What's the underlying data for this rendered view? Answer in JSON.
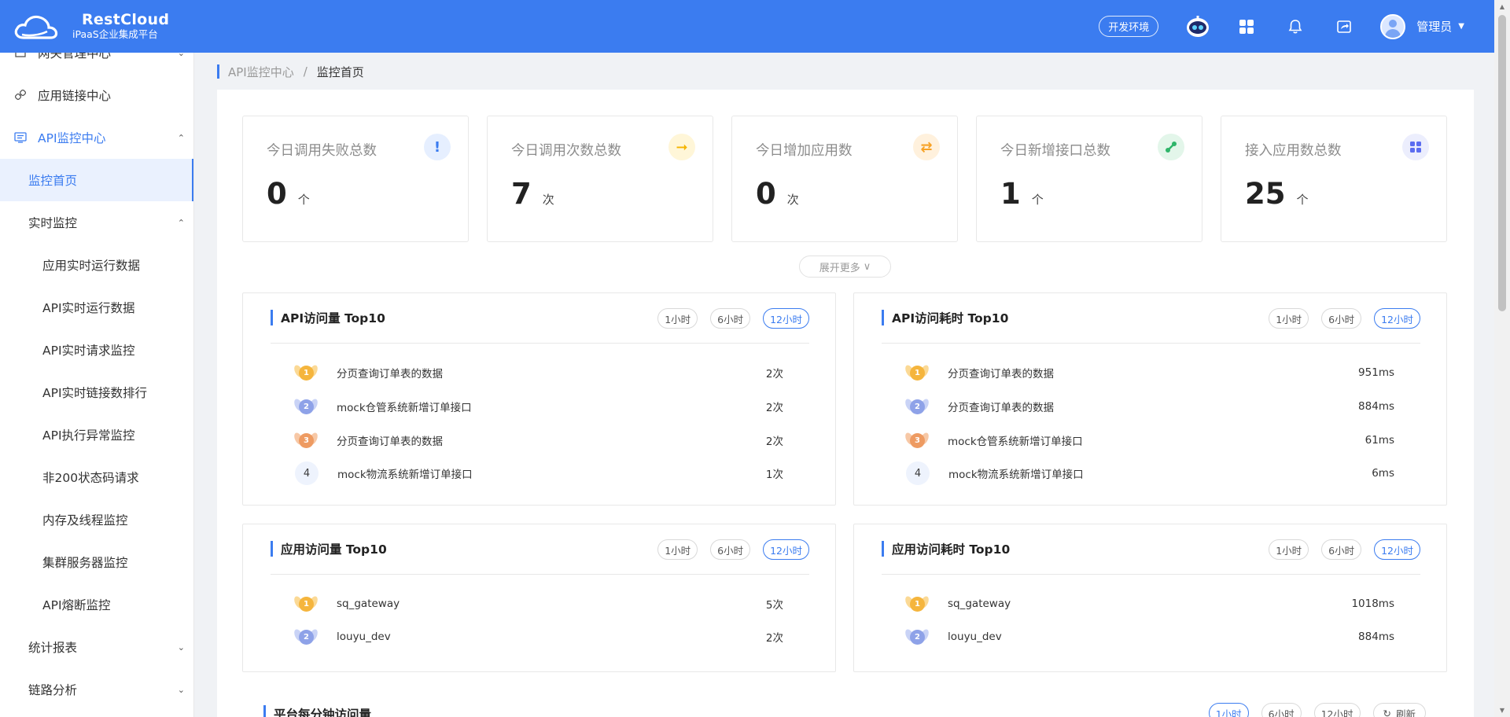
{
  "header": {
    "brand_title": "RestCloud",
    "brand_subtitle": "iPaaS企业集成平台",
    "env_label": "开发环境",
    "user_name": "管理员"
  },
  "sidebar": {
    "items": [
      {
        "label": "网关管理中心",
        "icon": "gateway-icon"
      },
      {
        "label": "应用链接中心",
        "icon": "link-icon"
      },
      {
        "label": "API监控中心",
        "icon": "monitor-icon"
      },
      {
        "label": "监控首页"
      },
      {
        "label": "实时监控"
      },
      {
        "label": "应用实时运行数据"
      },
      {
        "label": "API实时运行数据"
      },
      {
        "label": "API实时请求监控"
      },
      {
        "label": "API实时链接数排行"
      },
      {
        "label": "API执行异常监控"
      },
      {
        "label": "非200状态码请求"
      },
      {
        "label": "内存及线程监控"
      },
      {
        "label": "集群服务器监控"
      },
      {
        "label": "API熔断监控"
      },
      {
        "label": "统计报表"
      },
      {
        "label": "链路分析"
      }
    ]
  },
  "breadcrumb": {
    "parent": "API监控中心",
    "separator": "/",
    "current": "监控首页"
  },
  "stats": [
    {
      "label": "今日调用失败总数",
      "value": "0",
      "unit": "个",
      "icon": "alert-icon",
      "color": "#3b7cf0",
      "bg": "#e6efff"
    },
    {
      "label": "今日调用次数总数",
      "value": "7",
      "unit": "次",
      "icon": "arrow-right-icon",
      "color": "#f5b400",
      "bg": "#fff6d8"
    },
    {
      "label": "今日增加应用数",
      "value": "0",
      "unit": "次",
      "icon": "swap-icon",
      "color": "#f7a226",
      "bg": "#fff1dd"
    },
    {
      "label": "今日新增接口总数",
      "value": "1",
      "unit": "个",
      "icon": "connect-icon",
      "color": "#2fb56a",
      "bg": "#e3f6ea"
    },
    {
      "label": "接入应用数总数",
      "value": "25",
      "unit": "个",
      "icon": "apps-icon",
      "color": "#5b6cf0",
      "bg": "#eceefd"
    }
  ],
  "expand_label": "展开更多",
  "time_tabs": [
    "1小时",
    "6小时",
    "12小时"
  ],
  "panels": [
    {
      "title": "API访问量 Top10",
      "rows": [
        {
          "rank": "1",
          "name": "分页查询订单表的数据",
          "value": "2次"
        },
        {
          "rank": "2",
          "name": "mock仓管系统新增订单接口",
          "value": "2次"
        },
        {
          "rank": "3",
          "name": "分页查询订单表的数据",
          "value": "2次"
        },
        {
          "rank": "4",
          "name": "mock物流系统新增订单接口",
          "value": "1次"
        }
      ]
    },
    {
      "title": "API访问耗时 Top10",
      "rows": [
        {
          "rank": "1",
          "name": "分页查询订单表的数据",
          "value": "951ms"
        },
        {
          "rank": "2",
          "name": "分页查询订单表的数据",
          "value": "884ms"
        },
        {
          "rank": "3",
          "name": "mock仓管系统新增订单接口",
          "value": "61ms"
        },
        {
          "rank": "4",
          "name": "mock物流系统新增订单接口",
          "value": "6ms"
        }
      ]
    },
    {
      "title": "应用访问量 Top10",
      "rows": [
        {
          "rank": "1",
          "name": "sq_gateway",
          "value": "5次"
        },
        {
          "rank": "2",
          "name": "louyu_dev",
          "value": "2次"
        }
      ]
    },
    {
      "title": "应用访问耗时 Top10",
      "rows": [
        {
          "rank": "1",
          "name": "sq_gateway",
          "value": "1018ms"
        },
        {
          "rank": "2",
          "name": "louyu_dev",
          "value": "884ms"
        }
      ]
    }
  ],
  "bottom": {
    "title": "平台每分钟访问量",
    "refresh_label": "刷新"
  },
  "colors": {
    "accent": "#3b7cf0"
  }
}
